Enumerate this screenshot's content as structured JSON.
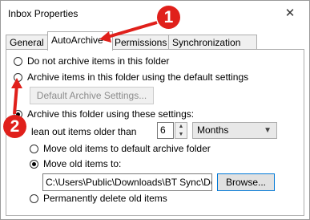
{
  "window": {
    "title": "Inbox Properties",
    "close_glyph": "✕"
  },
  "tabs": [
    {
      "label": "General",
      "active": false
    },
    {
      "label": "AutoArchive",
      "active": true
    },
    {
      "label": "Permissions",
      "active": false
    },
    {
      "label": "Synchronization",
      "active": false
    }
  ],
  "options": {
    "no_archive": "Do not archive items in this folder",
    "default_settings": "Archive items in this folder using the default settings",
    "default_button": "Default Archive Settings...",
    "these_settings": "Archive this folder using these settings:",
    "clean_out_label": "lean out items older than",
    "age_value": "6",
    "age_unit": "Months",
    "move_default": "Move old items to default archive folder",
    "move_to": "Move old items to:",
    "path_value": "C:\\Users\\Public\\Downloads\\BT Sync\\Doc",
    "browse_button": "Browse...",
    "delete": "Permanently delete old items"
  },
  "annotations": {
    "marker1": "1",
    "marker2": "2",
    "color": "#e0201b"
  }
}
